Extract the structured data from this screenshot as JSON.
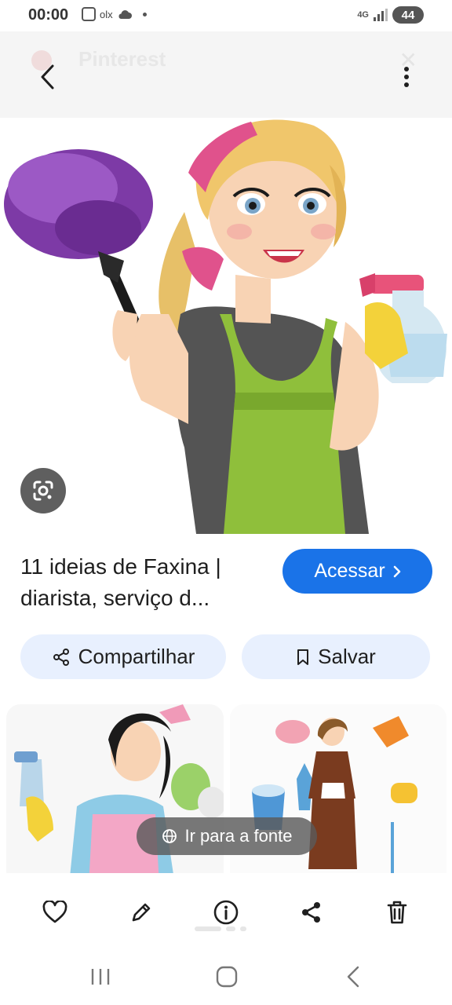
{
  "status_bar": {
    "time": "00:00",
    "olx_label": "olx",
    "network": "4G",
    "battery": "44"
  },
  "top_bar": {
    "faded_title": "Pinterest"
  },
  "result": {
    "title": "11 ideias de Faxina | diarista, serviço d...",
    "visit_label": "Acessar"
  },
  "actions": {
    "share_label": "Compartilhar",
    "save_label": "Salvar"
  },
  "related": {
    "source_label": "Ir para a fonte"
  },
  "colors": {
    "primary": "#1a73e8",
    "chip_bg": "#e8f0fe",
    "icon": "#1f1f1f"
  },
  "icons": {
    "back": "chevron-left-icon",
    "more": "more-vert-icon",
    "lens": "google-lens-icon",
    "share": "share-icon",
    "save": "bookmark-icon",
    "globe": "globe-icon",
    "toolbar": [
      "heart-icon",
      "pencil-icon",
      "info-icon",
      "share-icon",
      "trash-icon"
    ],
    "nav": [
      "recents-icon",
      "home-icon",
      "back-icon"
    ]
  }
}
